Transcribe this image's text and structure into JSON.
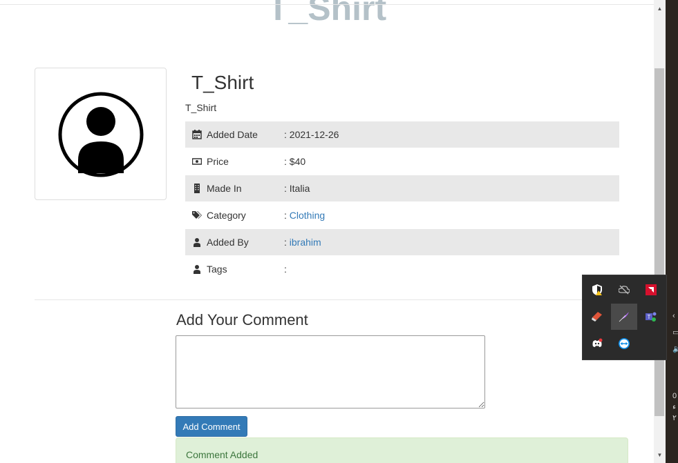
{
  "page": {
    "heading": "T_Shirt"
  },
  "item": {
    "title": "T_Shirt",
    "description": "T_Shirt",
    "info": [
      {
        "icon": "calendar-icon",
        "label": "Added Date",
        "value": ": 2021-12-26"
      },
      {
        "icon": "money-icon",
        "label": "Price",
        "value": ": $40"
      },
      {
        "icon": "building-icon",
        "label": "Made In",
        "value": ": Italia"
      },
      {
        "icon": "tags-icon",
        "label": "Category",
        "sep": ": ",
        "link": "Clothing"
      },
      {
        "icon": "user-icon",
        "label": "Added By",
        "sep": ": ",
        "link": "ibrahim"
      },
      {
        "icon": "user-icon",
        "label": "Tags",
        "value": ":"
      }
    ]
  },
  "comment": {
    "heading": "Add Your Comment",
    "button_label": "Add Comment",
    "alert": "Comment Added"
  },
  "taskbar": {
    "glyphs": [
      "‹",
      "▭",
      "🔈",
      "0",
      "ء",
      "٢٠"
    ]
  },
  "tray": {
    "icons": [
      "security-shield-icon",
      "cloud-off-icon",
      "amd-radeon-icon",
      "ccleaner-icon",
      "feather-icon",
      "teams-icon",
      "discord-icon",
      "teamviewer-icon"
    ]
  },
  "colors": {
    "accent": "#337ab7",
    "row_shade": "#e8e8e8",
    "alert_bg": "#dff0d8",
    "alert_text": "#3c763d",
    "heading_faded": "#b4c1c8"
  }
}
